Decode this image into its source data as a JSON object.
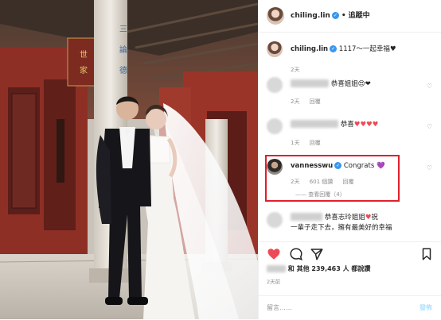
{
  "header": {
    "username": "chiling.lin",
    "separator": "•",
    "follow_state": "追蹤中"
  },
  "caption": {
    "username": "chiling.lin",
    "text": "1117～一起幸福♥",
    "time": "2天"
  },
  "comments": [
    {
      "text": "恭喜姐姐",
      "emoji": "😍❤",
      "time": "2天",
      "reply": "回覆"
    },
    {
      "text": "恭喜",
      "emoji": "♥♥♥♥",
      "time": "1天",
      "reply": "回覆"
    },
    {
      "username": "vannesswu",
      "text": "Congrats",
      "emoji": "💜",
      "time": "2天",
      "likes": "601 個讚",
      "reply": "回覆",
      "view_replies": "—— 查看回覆（4）"
    },
    {
      "line1": "恭喜志玲姐姐",
      "emoji": "♥",
      "line1_end": "祝",
      "line2": "一輩子走下去，擁有最美好的幸福"
    }
  ],
  "likes": {
    "prefix": "和 ",
    "label": "其他 239,463 人 都說讚"
  },
  "time_ago": "2天前",
  "compose": {
    "placeholder": "留言……",
    "post": "發佈"
  },
  "icons": [
    "heart-icon",
    "comment-icon",
    "share-icon",
    "bookmark-icon",
    "verified-icon"
  ],
  "colors": {
    "accent": "#3897f0",
    "heart": "#ed4956",
    "highlight": "#e0202a",
    "post_disabled": "#b2dffc"
  }
}
